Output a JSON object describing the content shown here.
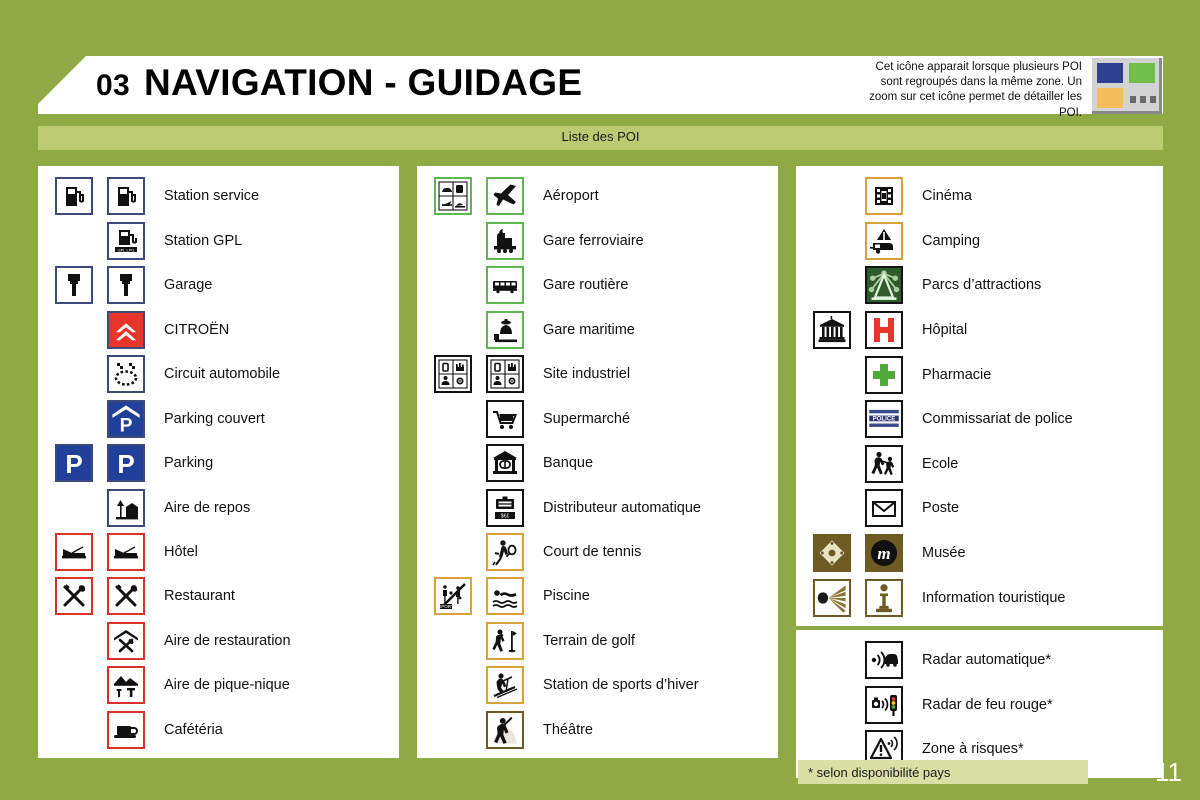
{
  "header": {
    "number": "03",
    "title": "NAVIGATION - GUIDAGE",
    "subtitle": "Liste des POI"
  },
  "note": {
    "text": "Cet icône apparait lorsque plusieurs POI sont regroupés dans la même zone. Un zoom sur cet icône permet de détailler les POI.",
    "icon_name": "grouped-poi-icon",
    "colors": {
      "blue": "#2e3f93",
      "green": "#6fbf4a",
      "orange": "#f5bc5c",
      "panel": "#d3d3d3"
    }
  },
  "theme": {
    "background": "#8fa944",
    "subbar": "#bccb72",
    "footnote_bar": "#d9e0a5",
    "panel": "#ffffff"
  },
  "columns": [
    {
      "id": "column-1",
      "rows": [
        {
          "label": "Station service",
          "icons": [
            "fuel-pump-icon",
            "fuel-pump-icon"
          ],
          "border": "blue"
        },
        {
          "label": "Station GPL",
          "icons": [
            null,
            "lpg-pump-icon"
          ],
          "border": "blue"
        },
        {
          "label": "Garage",
          "icons": [
            "wrench-icon",
            "wrench-icon"
          ],
          "border": "blue"
        },
        {
          "label": "CITROËN",
          "icons": [
            null,
            "citroen-logo-icon"
          ],
          "border": "blue"
        },
        {
          "label": "Circuit automobile",
          "icons": [
            null,
            "race-track-icon"
          ],
          "border": "blue"
        },
        {
          "label": "Parking couvert",
          "icons": [
            null,
            "covered-parking-icon"
          ],
          "border": "blue"
        },
        {
          "label": "Parking",
          "icons": [
            "parking-icon",
            "parking-icon"
          ],
          "border": "blue"
        },
        {
          "label": "Aire de repos",
          "icons": [
            null,
            "rest-area-icon"
          ],
          "border": "blue"
        },
        {
          "label": "Hôtel",
          "icons": [
            "bed-icon",
            "bed-icon"
          ],
          "border": "red"
        },
        {
          "label": "Restaurant",
          "icons": [
            "cutlery-icon",
            "cutlery-icon"
          ],
          "border": "red"
        },
        {
          "label": "Aire de restauration",
          "icons": [
            null,
            "food-area-icon"
          ],
          "border": "red"
        },
        {
          "label": "Aire de pique-nique",
          "icons": [
            null,
            "picnic-area-icon"
          ],
          "border": "red"
        },
        {
          "label": "Cafétéria",
          "icons": [
            null,
            "coffee-cup-icon"
          ],
          "border": "red"
        }
      ]
    },
    {
      "id": "column-2",
      "rows": [
        {
          "label": "Aéroport",
          "icons": [
            "transport-group-icon",
            "airplane-icon"
          ],
          "border": "green"
        },
        {
          "label": "Gare ferroviaire",
          "icons": [
            null,
            "train-icon"
          ],
          "border": "green"
        },
        {
          "label": "Gare routière",
          "icons": [
            null,
            "bus-icon"
          ],
          "border": "green"
        },
        {
          "label": "Gare maritime",
          "icons": [
            null,
            "ferry-icon"
          ],
          "border": "green"
        },
        {
          "label": "Site industriel",
          "icons": [
            "industry-group-icon",
            "industry-group-icon"
          ],
          "border": "black"
        },
        {
          "label": "Supermarché",
          "icons": [
            null,
            "shopping-cart-icon"
          ],
          "border": "black"
        },
        {
          "label": "Banque",
          "icons": [
            null,
            "bank-icon"
          ],
          "border": "black"
        },
        {
          "label": "Distributeur automatique",
          "icons": [
            null,
            "atm-icon"
          ],
          "border": "black"
        },
        {
          "label": "Court de tennis",
          "icons": [
            null,
            "tennis-icon"
          ],
          "border": "orange"
        },
        {
          "label": "Piscine",
          "icons": [
            "sports-group-icon",
            "swimmer-icon"
          ],
          "border": "orange"
        },
        {
          "label": "Terrain de golf",
          "icons": [
            null,
            "golf-icon"
          ],
          "border": "orange"
        },
        {
          "label": "Station de sports d’hiver",
          "icons": [
            null,
            "skier-icon"
          ],
          "border": "orange"
        },
        {
          "label": "Théâtre",
          "icons": [
            null,
            "theatre-icon"
          ],
          "border": "brown"
        }
      ]
    },
    {
      "id": "column-3",
      "rows": [
        {
          "label": "Cinéma",
          "icons": [
            null,
            "film-reel-icon"
          ],
          "border": "orange"
        },
        {
          "label": "Camping",
          "icons": [
            null,
            "caravan-icon"
          ],
          "border": "orange"
        },
        {
          "label": "Parcs d’attractions",
          "icons": [
            null,
            "amusement-park-icon"
          ],
          "border": "black"
        },
        {
          "label": "Hôpital",
          "icons": [
            "monument-icon",
            "hospital-h-icon"
          ],
          "border": "black"
        },
        {
          "label": "Pharmacie",
          "icons": [
            null,
            "pharmacy-cross-icon"
          ],
          "border": "black"
        },
        {
          "label": "Commissariat de police",
          "icons": [
            null,
            "police-icon"
          ],
          "border": "black"
        },
        {
          "label": "Ecole",
          "icons": [
            null,
            "school-icon"
          ],
          "border": "black"
        },
        {
          "label": "Poste",
          "icons": [
            null,
            "envelope-icon"
          ],
          "border": "black"
        },
        {
          "label": "Musée",
          "icons": [
            "museum-ornament-icon",
            "museum-m-icon"
          ],
          "border": "brown"
        },
        {
          "label": "Information touristique",
          "icons": [
            "tourist-burst-icon",
            "info-i-icon"
          ],
          "border": "brown"
        }
      ],
      "radar_rows": [
        {
          "label": "Radar automatique*",
          "icons": [
            null,
            "speed-camera-icon"
          ],
          "border": "black"
        },
        {
          "label": "Radar de feu rouge*",
          "icons": [
            null,
            "red-light-cam-icon"
          ],
          "border": "black"
        },
        {
          "label": "Zone à risques*",
          "icons": [
            null,
            "risk-zone-icon"
          ],
          "border": "black"
        }
      ]
    }
  ],
  "footnote": "* selon disponibilité pays",
  "page_number": "11"
}
